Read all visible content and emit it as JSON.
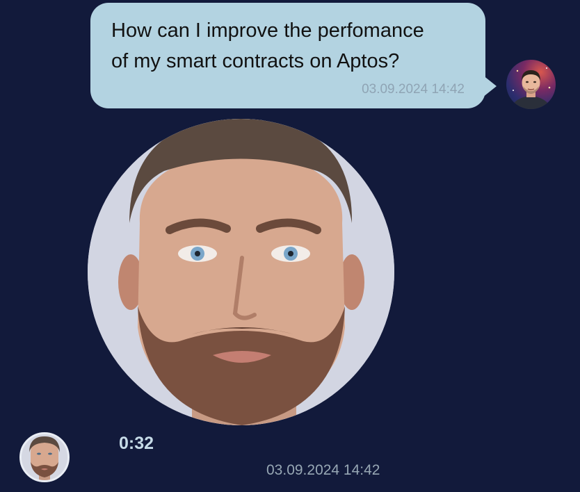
{
  "messages": {
    "outgoing": {
      "text_line1": "How can I improve the perfomance",
      "text_line2": "of my smart contracts on Aptos?",
      "timestamp": "03.09.2024 14:42",
      "avatar_icon": "user-avatar-icon"
    },
    "incoming": {
      "type": "video-note",
      "duration": "0:32",
      "timestamp": "03.09.2024 14:42",
      "avatar_icon": "bot-avatar-icon"
    }
  },
  "colors": {
    "background": "#121a3b",
    "bubble": "#b3d3e1",
    "bubble_time": "#8fa4b4",
    "duration": "#c6dbe7",
    "incoming_time": "#97a7b4"
  }
}
